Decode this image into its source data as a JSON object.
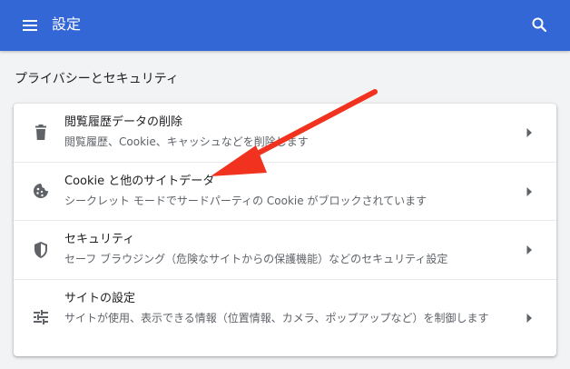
{
  "header": {
    "title": "設定",
    "menu_icon": "hamburger-menu-icon",
    "search_icon": "search-icon",
    "bg_color": "#3367d6"
  },
  "section": {
    "title": "プライバシーとセキュリティ"
  },
  "items": [
    {
      "title": "閲覧履歴データの削除",
      "subtitle": "閲覧履歴、Cookie、キャッシュなどを削除します",
      "icon": "trash-icon"
    },
    {
      "title": "Cookie と他のサイトデータ",
      "subtitle": "シークレット モードでサードパーティの Cookie がブロックされています",
      "icon": "cookie-icon"
    },
    {
      "title": "セキュリティ",
      "subtitle": "セーフ ブラウジング（危険なサイトからの保護機能）などのセキュリティ設定",
      "icon": "shield-icon"
    },
    {
      "title": "サイトの設定",
      "subtitle": "サイトが使用、表示できる情報（位置情報、カメラ、ポップアップなど）を制御します",
      "icon": "sliders-icon"
    }
  ],
  "annotation": {
    "arrow_color": "#f0321e"
  }
}
